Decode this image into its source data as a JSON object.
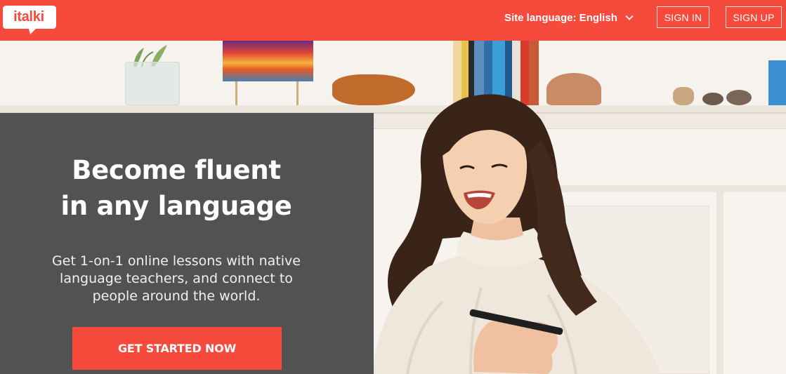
{
  "header": {
    "logo_text": "italki",
    "site_language_label": "Site language: English",
    "sign_in_label": "SIGN IN",
    "sign_up_label": "SIGN UP"
  },
  "hero": {
    "headline_line1": "Become fluent",
    "headline_line2": "in any language",
    "subtext_line1": "Get 1-on-1 online lessons with native",
    "subtext_line2": "language teachers, and connect to",
    "subtext_line3": "people around the world.",
    "cta_label": "GET STARTED NOW"
  },
  "colors": {
    "brand_red": "#f54a3c",
    "panel_overlay": "#3c3c3c",
    "text_white": "#ffffff"
  },
  "icons": {
    "logo": "italki-speech-bubble-logo",
    "language_dropdown": "chevron-down-icon"
  }
}
